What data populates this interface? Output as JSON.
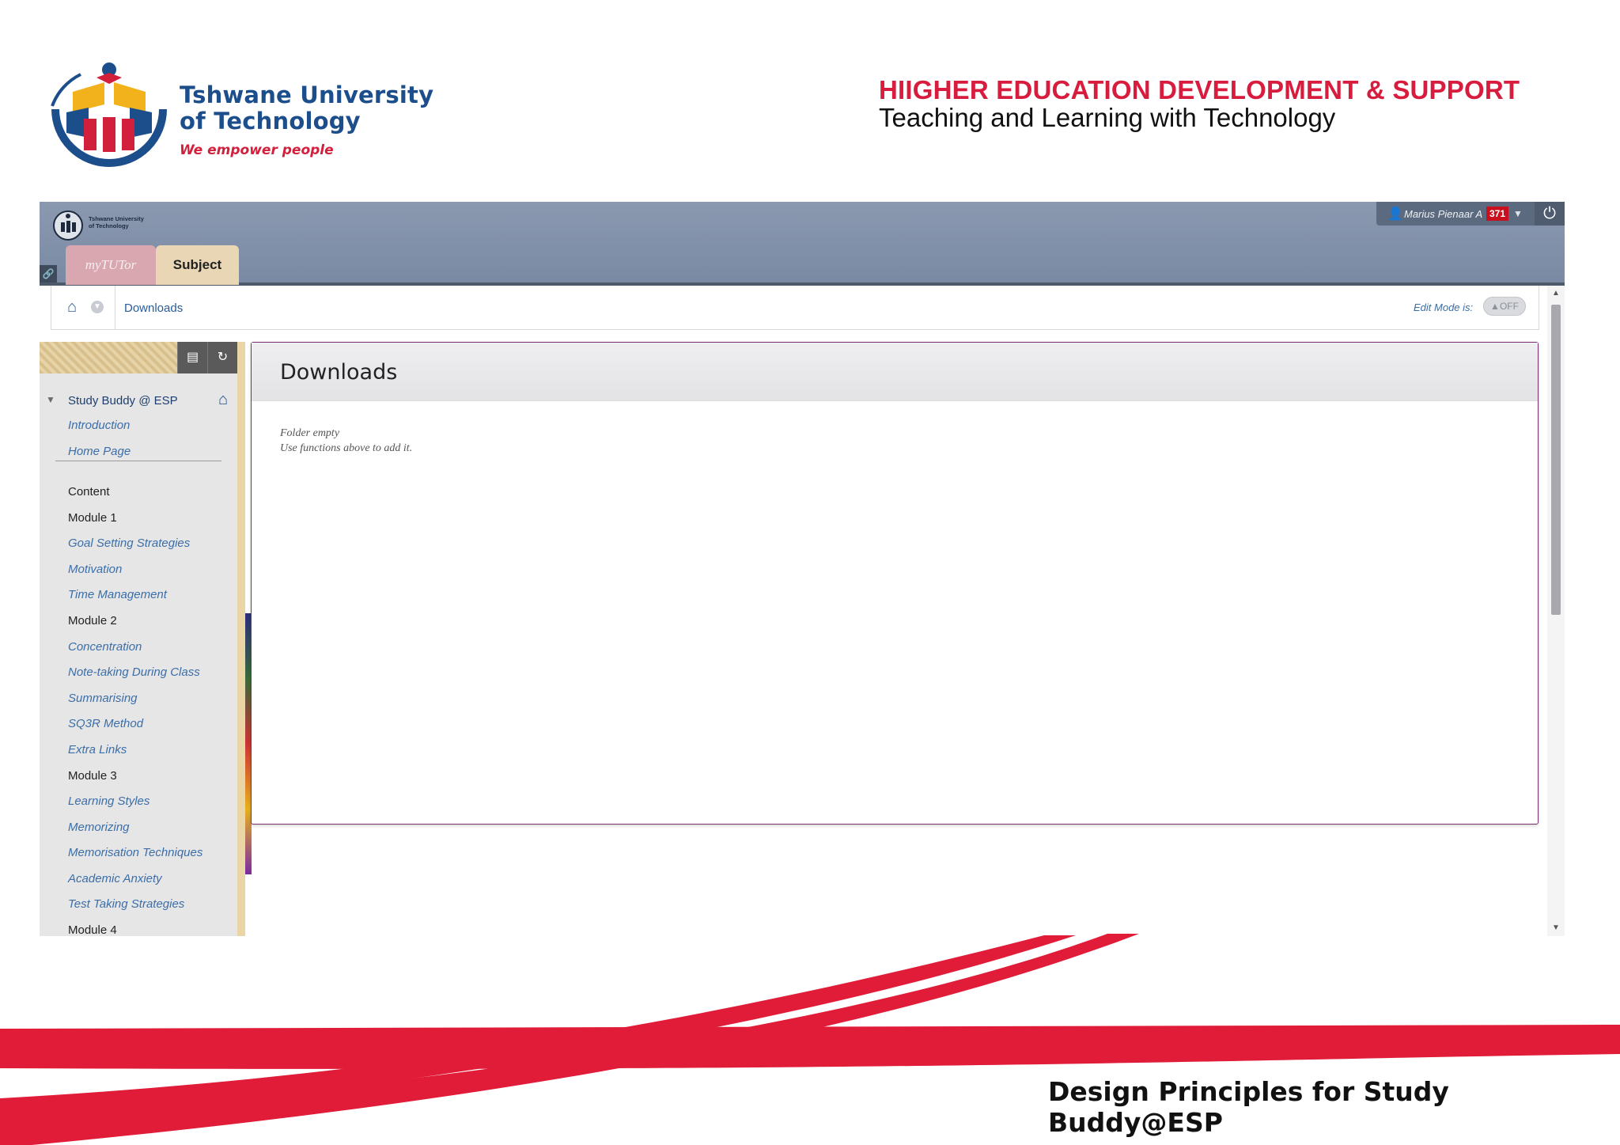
{
  "slide": {
    "institution_line1": "Tshwane University",
    "institution_line2": "of Technology",
    "institution_tagline": "We empower people",
    "header_title": "HIIGHER EDUCATION DEVELOPMENT & SUPPORT",
    "header_subtitle": "Teaching and Learning with Technology",
    "footer_title": "Design Principles for Study Buddy@ESP",
    "brand_red": "#d71c3e",
    "brand_blue": "#1c4e8c"
  },
  "lms": {
    "tabs": [
      {
        "label": "myTUTor",
        "active": false
      },
      {
        "label": "Subject",
        "active": true
      }
    ],
    "user": {
      "name": "Marius Pienaar A",
      "notification_count": "371",
      "user_icon": "person-icon",
      "power_icon": "power-icon"
    },
    "breadcrumb": {
      "current": "Downloads",
      "home_icon": "home-icon"
    },
    "edit_mode": {
      "label": "Edit Mode is:",
      "state": "OFF"
    },
    "menu": {
      "course_title": "Study Buddy @ ESP",
      "top_links": [
        "Introduction",
        "Home Page"
      ],
      "sections": [
        {
          "label": "Content",
          "type": "heading"
        },
        {
          "label": "Module 1",
          "type": "heading"
        },
        {
          "label": "Goal Setting Strategies",
          "type": "link"
        },
        {
          "label": "Motivation",
          "type": "link"
        },
        {
          "label": "Time Management",
          "type": "link"
        },
        {
          "label": "Module 2",
          "type": "heading"
        },
        {
          "label": "Concentration",
          "type": "link"
        },
        {
          "label": "Note-taking During Class",
          "type": "link"
        },
        {
          "label": "Summarising",
          "type": "link"
        },
        {
          "label": "SQ3R Method",
          "type": "link"
        },
        {
          "label": "Extra Links",
          "type": "link"
        },
        {
          "label": "Module 3",
          "type": "heading"
        },
        {
          "label": "Learning Styles",
          "type": "link"
        },
        {
          "label": "Memorizing",
          "type": "link"
        },
        {
          "label": "Memorisation Techniques",
          "type": "link"
        },
        {
          "label": "Academic Anxiety",
          "type": "link"
        },
        {
          "label": "Test Taking Strategies",
          "type": "link"
        },
        {
          "label": "Module 4",
          "type": "heading"
        }
      ]
    },
    "content": {
      "title": "Downloads",
      "empty_line1": "Folder empty",
      "empty_line2": "Use functions above to add it."
    }
  }
}
